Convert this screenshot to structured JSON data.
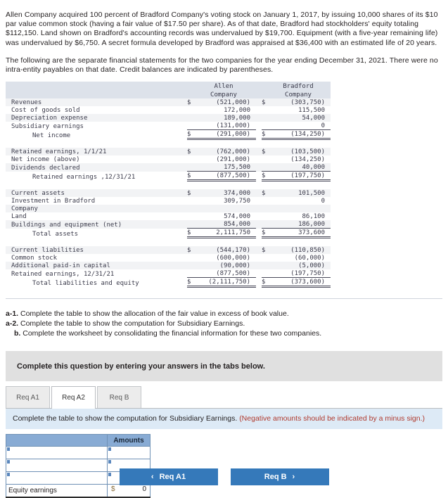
{
  "intro": {
    "para1": "Allen Company acquired 100 percent of Bradford Company's voting stock on January 1, 2017, by issuing 10,000 shares of its $10 par value common stock (having a fair value of $17.50 per share). As of that date, Bradford had stockholders' equity totaling $112,150. Land shown on Bradford's accounting records was undervalued by $19,700. Equipment (with a five-year remaining life) was undervalued by $6,750. A secret formula developed by Bradford was appraised at $36,400 with an estimated life of 20 years.",
    "para2": "The following are the separate financial statements for the two companies for the year ending December 31, 2021. There were no intra-entity payables on that date. Credit balances are indicated by parentheses."
  },
  "fin_table": {
    "col_headers": [
      {
        "line1": "Allen",
        "line2": "Company"
      },
      {
        "line1": "Bradford",
        "line2": "Company"
      }
    ],
    "rows": [
      {
        "label": "Revenues",
        "indent": 0,
        "allen_sym": "$",
        "allen": "(521,000)",
        "brad_sym": "$",
        "brad": "(303,750)",
        "rule": "none",
        "shade": true
      },
      {
        "label": "Cost of goods sold",
        "indent": 0,
        "allen_sym": "",
        "allen": "172,000",
        "brad_sym": "",
        "brad": "115,500",
        "rule": "none",
        "shade": false
      },
      {
        "label": "Depreciation expense",
        "indent": 0,
        "allen_sym": "",
        "allen": "189,000",
        "brad_sym": "",
        "brad": "54,000",
        "rule": "none",
        "shade": true
      },
      {
        "label": "Subsidiary earnings",
        "indent": 0,
        "allen_sym": "",
        "allen": "(131,000)",
        "brad_sym": "",
        "brad": "0",
        "rule": "single",
        "shade": false
      },
      {
        "label": "Net income",
        "indent": 1,
        "allen_sym": "$",
        "allen": "(291,000)",
        "brad_sym": "$",
        "brad": "(134,250)",
        "rule": "double",
        "shade": false
      },
      {
        "label": "Retained earnings, 1/1/21",
        "indent": 0,
        "allen_sym": "$",
        "allen": "(762,000)",
        "brad_sym": "$",
        "brad": "(103,500)",
        "rule": "none",
        "shade": true
      },
      {
        "label": "Net income (above)",
        "indent": 0,
        "allen_sym": "",
        "allen": "(291,000)",
        "brad_sym": "",
        "brad": "(134,250)",
        "rule": "none",
        "shade": false
      },
      {
        "label": "Dividends declared",
        "indent": 0,
        "allen_sym": "",
        "allen": "175,500",
        "brad_sym": "",
        "brad": "40,000",
        "rule": "single",
        "shade": true
      },
      {
        "label": "Retained earnings ,12/31/21",
        "indent": 1,
        "allen_sym": "$",
        "allen": "(877,500)",
        "brad_sym": "$",
        "brad": "(197,750)",
        "rule": "double",
        "shade": false
      },
      {
        "label": "Current assets",
        "indent": 0,
        "allen_sym": "$",
        "allen": "374,000",
        "brad_sym": "$",
        "brad": "101,500",
        "rule": "none",
        "shade": true
      },
      {
        "label": "Investment in Bradford",
        "indent": 0,
        "allen_sym": "",
        "allen": "309,750",
        "brad_sym": "",
        "brad": "0",
        "rule": "none",
        "shade": false
      },
      {
        "label": "Company",
        "indent": 0,
        "allen_sym": "",
        "allen": "",
        "brad_sym": "",
        "brad": "",
        "rule": "none",
        "shade": true
      },
      {
        "label": "Land",
        "indent": 0,
        "allen_sym": "",
        "allen": "574,000",
        "brad_sym": "",
        "brad": "86,100",
        "rule": "none",
        "shade": false
      },
      {
        "label": "Buildings and equipment (net)",
        "indent": 0,
        "allen_sym": "",
        "allen": "854,000",
        "brad_sym": "",
        "brad": "186,000",
        "rule": "single",
        "shade": true
      },
      {
        "label": "Total assets",
        "indent": 1,
        "allen_sym": "$",
        "allen": "2,111,750",
        "brad_sym": "$",
        "brad": "373,600",
        "rule": "double",
        "shade": false
      },
      {
        "label": "Current liabilities",
        "indent": 0,
        "allen_sym": "$",
        "allen": "(544,170)",
        "brad_sym": "$",
        "brad": "(110,850)",
        "rule": "none",
        "shade": true
      },
      {
        "label": "Common stock",
        "indent": 0,
        "allen_sym": "",
        "allen": "(600,000)",
        "brad_sym": "",
        "brad": "(60,000)",
        "rule": "none",
        "shade": false
      },
      {
        "label": "Additional paid-in capital",
        "indent": 0,
        "allen_sym": "",
        "allen": "(90,000)",
        "brad_sym": "",
        "brad": "(5,000)",
        "rule": "none",
        "shade": true
      },
      {
        "label": "Retained earnings, 12/31/21",
        "indent": 0,
        "allen_sym": "",
        "allen": "(877,500)",
        "brad_sym": "",
        "brad": "(197,750)",
        "rule": "single",
        "shade": false
      },
      {
        "label": "Total liabilities and equity",
        "indent": 1,
        "allen_sym": "$",
        "allen": "(2,111,750)",
        "brad_sym": "$",
        "brad": "(373,600)",
        "rule": "double",
        "shade": false
      }
    ]
  },
  "requirements": [
    {
      "marker": "a-1.",
      "text": " Complete the table to show the allocation of the fair value in excess of book value."
    },
    {
      "marker": "a-2.",
      "text": " Complete the table to show the computation for Subsidiary Earnings."
    },
    {
      "marker": "b.",
      "text": " Complete the worksheet by consolidating the financial information for these two companies."
    }
  ],
  "grey_band": {
    "text": "Complete this question by entering your answers in the tabs below."
  },
  "tabs": [
    {
      "label": "Req A1",
      "active": false
    },
    {
      "label": "Req A2",
      "active": true
    },
    {
      "label": "Req B",
      "active": false
    }
  ],
  "blue_bar": {
    "main": "Complete the table to show the computation for Subsidiary Earnings. ",
    "note": "(Negative amounts should be indicated by a minus sign.)"
  },
  "answer_table": {
    "header_label": "",
    "header_amount": "Amounts",
    "input_rows": [
      {
        "label": "",
        "amount": ""
      },
      {
        "label": "",
        "amount": ""
      },
      {
        "label": "",
        "amount": ""
      }
    ],
    "total_row": {
      "label": "Equity earnings",
      "dollar": "$",
      "amount": "0"
    }
  },
  "nav": {
    "prev": {
      "chevron": "‹",
      "label": "Req A1"
    },
    "next": {
      "label": "Req B",
      "chevron": "›"
    }
  },
  "colors": {
    "button_blue": "#3579ba",
    "table_header_blue": "#88abd4",
    "blue_bar_bg": "#ddeaf6",
    "grey_band_bg": "#e0e0e0",
    "fin_header_bg": "#dde2ea",
    "negative_note": "#b03a2e"
  }
}
